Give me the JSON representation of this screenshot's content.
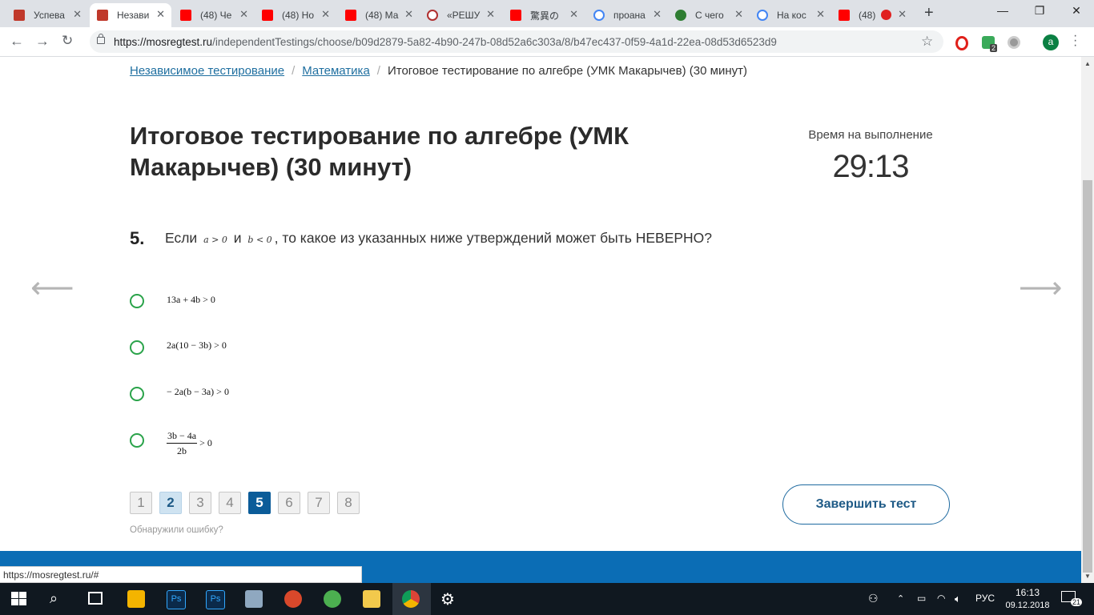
{
  "browser": {
    "tabs": [
      {
        "title": "Успева",
        "color": "#c0392b"
      },
      {
        "title": "Незави",
        "color": "#c0392b",
        "active": true
      },
      {
        "title": "(48) Че",
        "color": "#ff0000"
      },
      {
        "title": "(48) Но",
        "color": "#ff0000"
      },
      {
        "title": "(48) Ма",
        "color": "#ff0000"
      },
      {
        "title": "«РЕШУ",
        "color": "#b03030"
      },
      {
        "title": "驚異の",
        "color": "#ff0000"
      },
      {
        "title": "проана",
        "color": "#4285f4"
      },
      {
        "title": "С чего",
        "color": "#2e7d32"
      },
      {
        "title": "На кос",
        "color": "#4285f4"
      },
      {
        "title": "(48) ",
        "color": "#ff0000"
      }
    ],
    "url_domain": "https://mosregtest.ru",
    "url_path": "/independentTestings/choose/b09d2879-5a82-4b90-247b-08d52a6c303a/8/b47ec437-0f59-4a1d-22ea-08d53d6523d9",
    "ext_badge": "2",
    "profile_letter": "a",
    "status_url": "https://mosregtest.ru/#"
  },
  "breadcrumb": {
    "home": "Независимое тестирование",
    "section": "Математика",
    "current": "Итоговое тестирование по алгебре (УМК Макарычев) (30 минут)"
  },
  "page": {
    "title": "Итоговое тестирование по алгебре (УМК Макарычев) (30 минут)",
    "timer_label": "Время на выполнение",
    "timer_value": "29:13"
  },
  "question": {
    "number": "5.",
    "text_start": "Если",
    "cond1": "a > 0",
    "text_and": "и",
    "cond2": "b < 0",
    "text_end": ", то какое из указанных ниже утверждений может быть НЕВЕРНО?"
  },
  "options": [
    {
      "label": "13a + 4b > 0"
    },
    {
      "label": "2a(10 − 3b) > 0"
    },
    {
      "label": "− 2a(b − 3a) > 0"
    },
    {
      "numerator": "3b − 4a",
      "denominator": "2b",
      "rest": " > 0"
    }
  ],
  "pagination": [
    {
      "label": "1",
      "state": "default"
    },
    {
      "label": "2",
      "state": "visited"
    },
    {
      "label": "3",
      "state": "default"
    },
    {
      "label": "4",
      "state": "default"
    },
    {
      "label": "5",
      "state": "current"
    },
    {
      "label": "6",
      "state": "default"
    },
    {
      "label": "7",
      "state": "default"
    },
    {
      "label": "8",
      "state": "default"
    }
  ],
  "actions": {
    "finish_label": "Завершить тест",
    "report_label": "Обнаружили ошибку?"
  },
  "taskbar": {
    "language": "РУС",
    "time": "16:13",
    "date": "09.12.2018",
    "notifications": "21"
  },
  "colors": {
    "link": "#1f6fa0",
    "radio": "#2aa34a",
    "accent": "#0b5c99",
    "footer": "#0b6db5"
  }
}
